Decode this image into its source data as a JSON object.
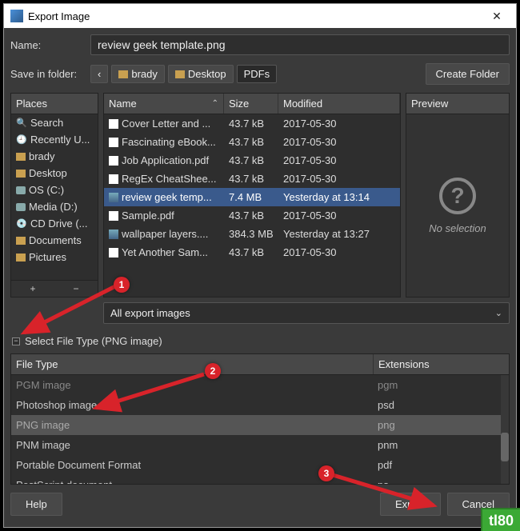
{
  "titlebar": {
    "title": "Export Image"
  },
  "name_row": {
    "label": "Name:",
    "value": "review geek template.png"
  },
  "save_row": {
    "label": "Save in folder:",
    "back": "‹",
    "path": [
      "brady",
      "Desktop",
      "PDFs"
    ],
    "create_folder": "Create Folder"
  },
  "places": {
    "header": "Places",
    "items": [
      {
        "icon": "🔍",
        "label": "Search"
      },
      {
        "icon": "🕘",
        "label": "Recently U..."
      },
      {
        "icon": "folder",
        "label": "brady"
      },
      {
        "icon": "folder",
        "label": "Desktop"
      },
      {
        "icon": "drive",
        "label": "OS (C:)"
      },
      {
        "icon": "drive",
        "label": "Media (D:)"
      },
      {
        "icon": "💿",
        "label": "CD Drive (..."
      },
      {
        "icon": "folder",
        "label": "Documents"
      },
      {
        "icon": "folder",
        "label": "Pictures"
      }
    ]
  },
  "files": {
    "columns": {
      "name": "Name",
      "size": "Size",
      "modified": "Modified"
    },
    "rows": [
      {
        "icon": "file",
        "name": "Cover Letter and ...",
        "size": "43.7 kB",
        "modified": "2017-05-30"
      },
      {
        "icon": "file",
        "name": "Fascinating eBook...",
        "size": "43.7 kB",
        "modified": "2017-05-30"
      },
      {
        "icon": "file",
        "name": "Job Application.pdf",
        "size": "43.7 kB",
        "modified": "2017-05-30"
      },
      {
        "icon": "file",
        "name": "RegEx CheatShee...",
        "size": "43.7 kB",
        "modified": "2017-05-30"
      },
      {
        "icon": "img",
        "name": "review geek temp...",
        "size": "7.4 MB",
        "modified": "Yesterday at 13:14",
        "selected": true
      },
      {
        "icon": "file",
        "name": "Sample.pdf",
        "size": "43.7 kB",
        "modified": "2017-05-30"
      },
      {
        "icon": "img",
        "name": "wallpaper layers....",
        "size": "384.3 MB",
        "modified": "Yesterday at 13:27"
      },
      {
        "icon": "file",
        "name": "Yet Another Sam...",
        "size": "43.7 kB",
        "modified": "2017-05-30"
      }
    ]
  },
  "preview": {
    "header": "Preview",
    "text": "No selection"
  },
  "filter": {
    "value": "All export images"
  },
  "expander": {
    "label": "Select File Type (PNG image)"
  },
  "types": {
    "columns": {
      "ft": "File Type",
      "ext": "Extensions"
    },
    "rows": [
      {
        "ft": "PGM image",
        "ext": "pgm",
        "dim": true
      },
      {
        "ft": "Photoshop image",
        "ext": "psd"
      },
      {
        "ft": "PNG image",
        "ext": "png",
        "selected": true
      },
      {
        "ft": "PNM image",
        "ext": "pnm"
      },
      {
        "ft": "Portable Document Format",
        "ext": "pdf"
      },
      {
        "ft": "PostScript document",
        "ext": "ps"
      }
    ]
  },
  "footer": {
    "help": "Help",
    "export": "Export",
    "cancel": "Cancel"
  },
  "annotations": {
    "b1": "1",
    "b2": "2",
    "b3": "3"
  },
  "watermark": "tl80"
}
